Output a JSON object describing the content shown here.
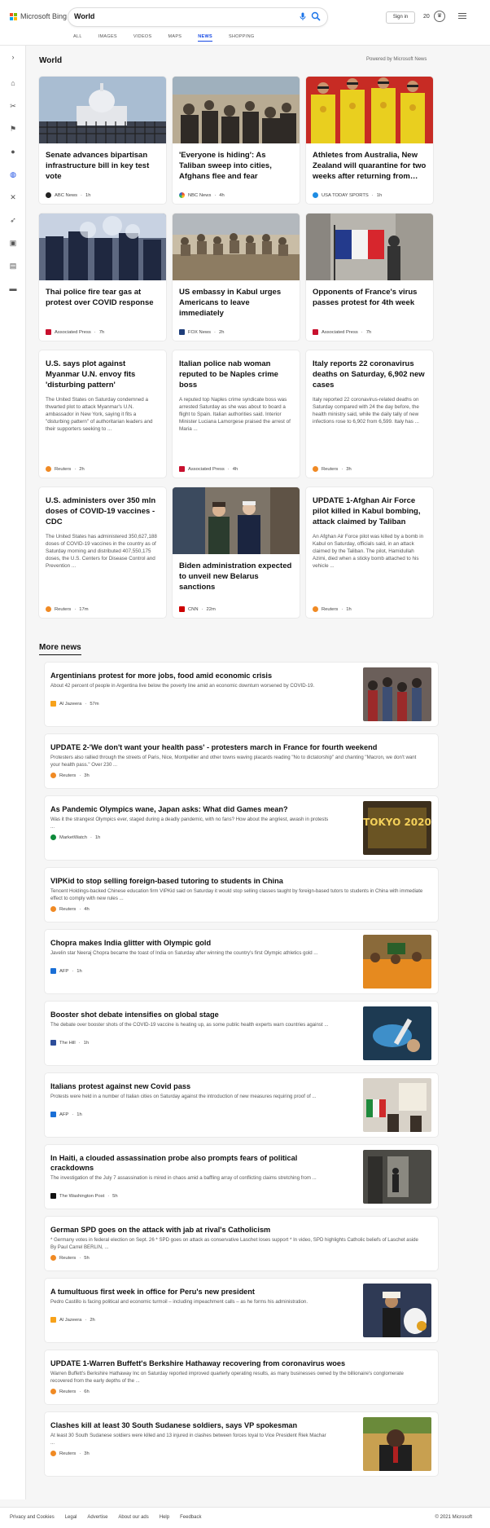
{
  "header": {
    "brand": "Microsoft Bing",
    "search_value": "World",
    "sign_in": "Sign in",
    "points": "20",
    "tabs": [
      {
        "label": "ALL"
      },
      {
        "label": "IMAGES"
      },
      {
        "label": "VIDEOS"
      },
      {
        "label": "MAPS"
      },
      {
        "label": "NEWS",
        "active": true
      },
      {
        "label": "SHOPPING"
      }
    ]
  },
  "sidebar": {
    "icons": [
      "expand-icon",
      "home-icon",
      "discover-icon",
      "flag-icon",
      "location-icon",
      "world-icon",
      "science-icon",
      "rocket-icon",
      "entertainment-icon",
      "business-icon",
      "money-icon"
    ]
  },
  "world": {
    "title": "World",
    "powered_by": "Powered by Microsoft News",
    "cards": [
      {
        "title": "Senate advances bipartisan infrastructure bill in key test vote",
        "source": "ABC News",
        "time": "1h",
        "image": "capitol"
      },
      {
        "title": "'Everyone is hiding': As Taliban sweep into cities, Afghans flee and fear",
        "source": "NBC News",
        "time": "4h",
        "image": "crowd"
      },
      {
        "title": "Athletes from Australia, New Zealand will quarantine for two weeks after returning from…",
        "source": "USA TODAY SPORTS",
        "time": "1h",
        "image": "podium"
      },
      {
        "title": "Thai police fire tear gas at protest over COVID response",
        "source": "Associated Press",
        "time": "7h",
        "image": "police"
      },
      {
        "title": "US embassy in Kabul urges Americans to leave immediately",
        "source": "FOX News",
        "time": "2h",
        "image": "kabul"
      },
      {
        "title": "Opponents of France's virus passes protest for 4th week",
        "source": "Associated Press",
        "time": "7h",
        "image": "flag"
      },
      {
        "title": "U.S. says plot against Myanmar U.N. envoy fits 'disturbing pattern'",
        "desc": "The United States on Saturday condemned a thwarted plot to attack Myanmar's U.N. ambassador in New York, saying it fits a \"disturbing pattern\" of authoritarian leaders and their supporters seeking to ...",
        "source": "Reuters",
        "time": "2h"
      },
      {
        "title": "Italian police nab woman reputed to be Naples crime boss",
        "desc": "A reputed top Naples crime syndicate boss was arrested Saturday as she was about to board a flight to Spain. Italian authorities said. Interior Minister Luciana Lamorgese praised the arrest of Maria ...",
        "source": "Associated Press",
        "time": "4h"
      },
      {
        "title": "Italy reports 22 coronavirus deaths on Saturday, 6,902 new cases",
        "desc": "Italy reported 22 coronavirus-related deaths on Saturday compared with 24 the day before, the health ministry said, while the daily tally of new infections rose to 6,902 from 6,599. Italy has ...",
        "source": "Reuters",
        "time": "3h"
      },
      {
        "title": "U.S. administers over 350 mln doses of COVID-19 vaccines - CDC",
        "desc": "The United States has administered 350,627,188 doses of COVID-19 vaccines in the country as of Saturday morning and distributed 407,550,175 doses, the U.S. Centers for Disease Control and Prevention ...",
        "source": "Reuters",
        "time": "17m"
      },
      {
        "title": "Biden administration expected to unveil new Belarus sanctions",
        "source": "CNN",
        "time": "22m",
        "image": "biden"
      },
      {
        "title": "UPDATE 1-Afghan Air Force pilot killed in Kabul bombing, attack claimed by Taliban",
        "desc": "An Afghan Air Force pilot was killed by a bomb in Kabul on Saturday, officials said, in an attack claimed by the Taliban. The pilot, Hamidullah Azimi, died when a sticky bomb attached to his vehicle ...",
        "source": "Reuters",
        "time": "1h"
      }
    ]
  },
  "more_news": {
    "title": "More news",
    "items": [
      {
        "title": "Argentinians protest for more jobs, food amid economic crisis",
        "desc": "About 42 percent of people in Argentina live below the poverty line amid an economic downturn worsened by COVID-19.",
        "source": "Al Jazeera",
        "time": "57m",
        "image": "argentina"
      },
      {
        "title": "UPDATE 2-'We don't want your health pass' - protesters march in France for fourth weekend",
        "desc": "Protesters also rallied through the streets of Paris, Nice, Montpellier and other towns waving placards reading \"No to dictatorship\" and chanting \"Macron, we don't want your health pass.\" Over 230 ...",
        "source": "Reuters",
        "time": "3h"
      },
      {
        "title": "As Pandemic Olympics wane, Japan asks: What did Games mean?",
        "desc": "Was it the strangest Olympics ever, staged during a deadly pandemic, with no fans? How about the angriest, awash in protests ...",
        "source": "MarketWatch",
        "time": "1h",
        "image": "tokyo",
        "image_text": "TOKYO 2020"
      },
      {
        "title": "VIPKid to stop selling foreign-based tutoring to students in China",
        "desc": "Tencent Holdings-backed Chinese education firm VIPKid said on Saturday it would stop selling classes taught by foreign-based tutors to students in China with immediate effect to comply with new rules ...",
        "source": "Reuters",
        "time": "4h"
      },
      {
        "title": "Chopra makes India glitter with Olympic gold",
        "desc": "Javelin star Neeraj Chopra became the toast of India on Saturday after winning the country's first Olympic athletics gold ...",
        "source": "AFP",
        "time": "1h",
        "image": "chopra"
      },
      {
        "title": "Booster shot debate intensifies on global stage",
        "desc": "The debate over booster shots of the COVID-19 vaccine is heating up, as some public health experts warn countries against ...",
        "source": "The Hill",
        "time": "1h",
        "image": "vaccine"
      },
      {
        "title": "Italians protest against new Covid pass",
        "desc": "Protests were held in a number of Italian cities on Saturday against the introduction of new measures requiring proof of ...",
        "source": "AFP",
        "time": "1h",
        "image": "italy"
      },
      {
        "title": "In Haiti, a clouded assassination probe also prompts fears of political crackdowns",
        "desc": "The investigation of the July 7 assassination is mired in chaos amid a baffling array of conflicting claims stretching from ...",
        "source": "The Washington Post",
        "time": "5h",
        "image": "haiti"
      },
      {
        "title": "German SPD goes on the attack with jab at rival's Catholicism",
        "desc": "* Germany votes in federal election on Sept. 26 * SPD goes on attack as conservative Laschet loses support * In video, SPD highlights Catholic beliefs of Laschet aside By Paul Carrel BERLIN, ...",
        "source": "Reuters",
        "time": "5h"
      },
      {
        "title": "A tumultuous first week in office for Peru's new president",
        "desc": "Pedro Castillo is facing political and economic turmoil – including impeachment calls – as he forms his administration.",
        "source": "Al Jazeera",
        "time": "2h",
        "image": "peru"
      },
      {
        "title": "UPDATE 1-Warren Buffett's Berkshire Hathaway recovering from coronavirus woes",
        "desc": "Warren Buffett's Berkshire Hathaway Inc on Saturday reported improved quarterly operating results, as many businesses owned by the billionaire's conglomerate recovered from the early depths of the ...",
        "source": "Reuters",
        "time": "6h"
      },
      {
        "title": "Clashes kill at least 30 South Sudanese soldiers, says VP spokesman",
        "desc": "At least 30 South Sudanese soldiers were killed and 13 injured in clashes between forces loyal to Vice President Riek Machar ...",
        "source": "Reuters",
        "time": "3h",
        "image": "sudan"
      }
    ]
  },
  "footer": {
    "links": [
      "Privacy and Cookies",
      "Legal",
      "Advertise",
      "About our ads",
      "Help",
      "Feedback"
    ],
    "copyright": "© 2021 Microsoft"
  },
  "colors": {
    "accent": "#174ae4",
    "search_icon": "#1a73e8"
  }
}
